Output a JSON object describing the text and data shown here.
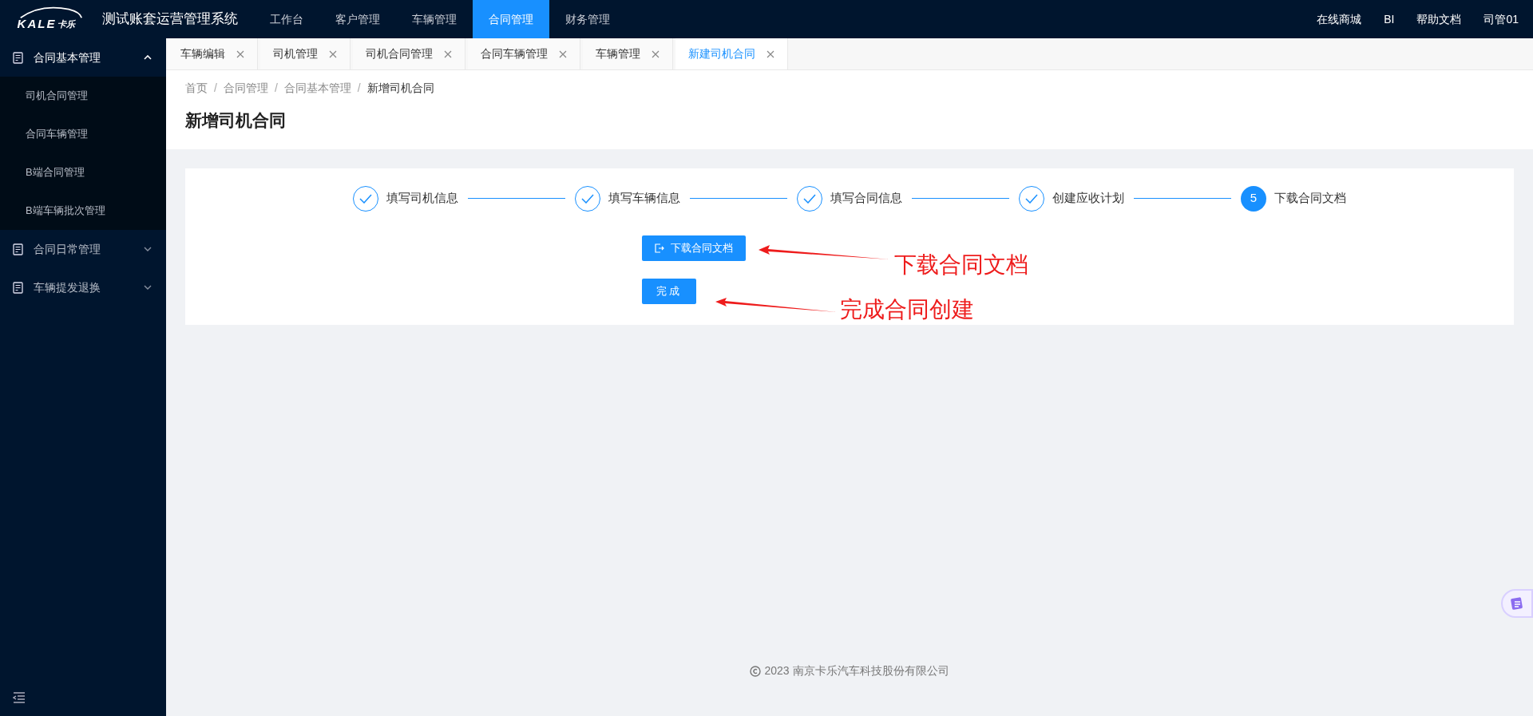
{
  "header": {
    "logo": {
      "mark": "KALE",
      "suffix": "卡乐"
    },
    "title": "测试账套运营管理系统",
    "nav": [
      {
        "label": "工作台",
        "selected": false
      },
      {
        "label": "客户管理",
        "selected": false
      },
      {
        "label": "车辆管理",
        "selected": false
      },
      {
        "label": "合同管理",
        "selected": true
      },
      {
        "label": "财务管理",
        "selected": false
      }
    ],
    "links": [
      "在线商城",
      "BI",
      "帮助文档",
      "司管01"
    ]
  },
  "sidebar": {
    "groups": [
      {
        "label": "合同基本管理",
        "expanded": true,
        "children": [
          {
            "label": "司机合同管理"
          },
          {
            "label": "合同车辆管理"
          },
          {
            "label": "B端合同管理"
          },
          {
            "label": "B端车辆批次管理"
          }
        ]
      },
      {
        "label": "合同日常管理",
        "expanded": false
      },
      {
        "label": "车辆提发退换",
        "expanded": false
      }
    ]
  },
  "tabs": [
    {
      "label": "车辆编辑",
      "selected": false
    },
    {
      "label": "司机管理",
      "selected": false
    },
    {
      "label": "司机合同管理",
      "selected": false
    },
    {
      "label": "合同车辆管理",
      "selected": false
    },
    {
      "label": "车辆管理",
      "selected": false
    },
    {
      "label": "新建司机合同",
      "selected": true
    }
  ],
  "breadcrumb": [
    "首页",
    "合同管理",
    "合同基本管理",
    "新增司机合同"
  ],
  "breadcrumb_separator": "/",
  "page_title": "新增司机合同",
  "steps": [
    {
      "label": "填写司机信息",
      "completed": true
    },
    {
      "label": "填写车辆信息",
      "completed": true
    },
    {
      "label": "填写合同信息",
      "completed": true
    },
    {
      "label": "创建应收计划",
      "completed": true
    },
    {
      "label": "下载合同文档",
      "completed": false,
      "number": "5"
    }
  ],
  "buttons": [
    {
      "label": "下载合同文档",
      "kind": "download"
    },
    {
      "label": "完成",
      "kind": "plain"
    }
  ],
  "annotations": [
    "下载合同文档",
    "完成合同创建"
  ],
  "footer": "2023 南京卡乐汽车科技股份有限公司"
}
